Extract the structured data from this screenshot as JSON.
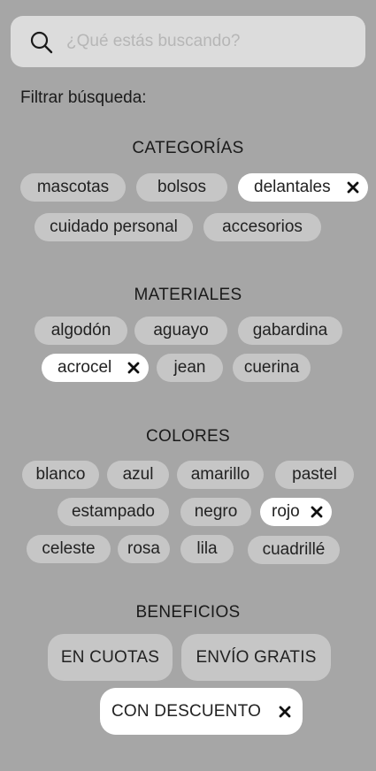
{
  "search": {
    "placeholder": "¿Qué estás buscando?",
    "value": ""
  },
  "filter_label": "Filtrar búsqueda:",
  "sections": [
    {
      "title": "CATEGORÍAS",
      "chips": [
        {
          "label": "mascotas",
          "selected": false
        },
        {
          "label": "bolsos",
          "selected": false
        },
        {
          "label": "delantales",
          "selected": true
        },
        {
          "label": "cuidado personal",
          "selected": false
        },
        {
          "label": "accesorios",
          "selected": false
        }
      ]
    },
    {
      "title": "MATERIALES",
      "chips": [
        {
          "label": "algodón",
          "selected": false
        },
        {
          "label": "aguayo",
          "selected": false
        },
        {
          "label": "gabardina",
          "selected": false
        },
        {
          "label": "acrocel",
          "selected": true
        },
        {
          "label": "jean",
          "selected": false
        },
        {
          "label": "cuerina",
          "selected": false
        }
      ]
    },
    {
      "title": "COLORES",
      "chips": [
        {
          "label": "blanco",
          "selected": false
        },
        {
          "label": "azul",
          "selected": false
        },
        {
          "label": "amarillo",
          "selected": false
        },
        {
          "label": "pastel",
          "selected": false
        },
        {
          "label": "estampado",
          "selected": false
        },
        {
          "label": "negro",
          "selected": false
        },
        {
          "label": "rojo",
          "selected": true
        },
        {
          "label": "celeste",
          "selected": false
        },
        {
          "label": "rosa",
          "selected": false
        },
        {
          "label": "lila",
          "selected": false
        },
        {
          "label": "cuadrillé",
          "selected": false
        }
      ]
    },
    {
      "title": "BENEFICIOS",
      "chips": [
        {
          "label": "EN CUOTAS",
          "selected": false
        },
        {
          "label": "ENVÍO GRATIS",
          "selected": false
        },
        {
          "label": "CON DESCUENTO",
          "selected": true
        }
      ]
    }
  ],
  "icons": {
    "search": "search-icon",
    "remove": "close-icon"
  },
  "colors": {
    "background": "#a6a6a6",
    "search_bg": "#dcdcdc",
    "chip_bg": "#c6c6c6",
    "chip_selected_bg": "#ffffff",
    "text": "#1f1f1f"
  }
}
